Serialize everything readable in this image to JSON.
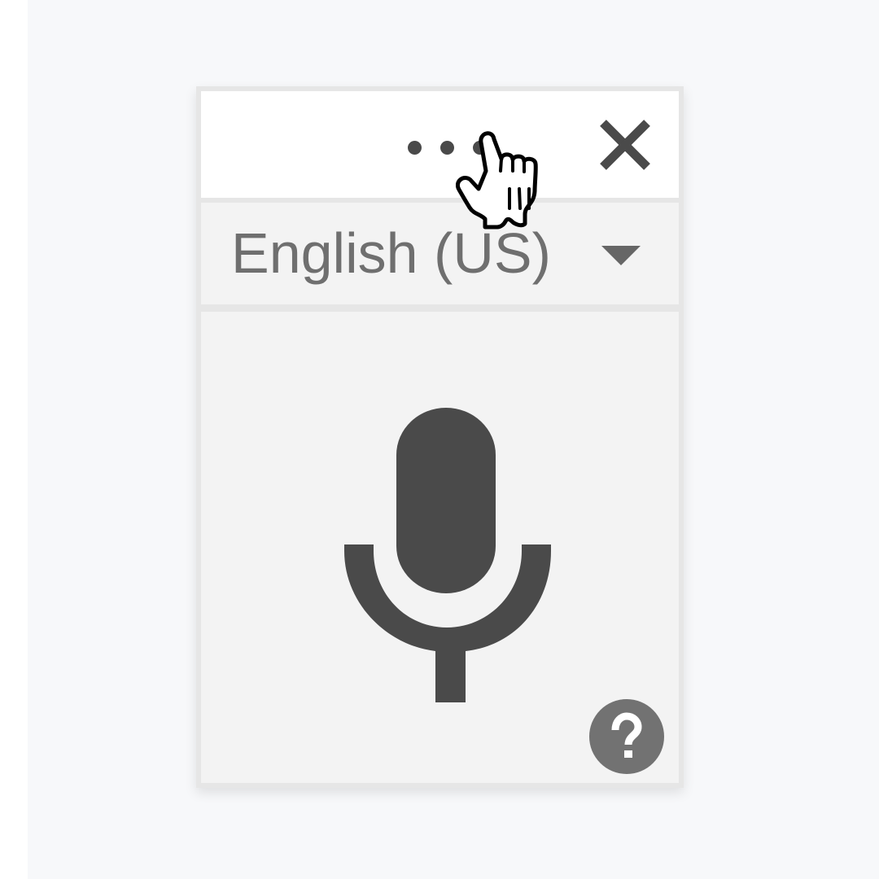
{
  "dialog": {
    "language": {
      "selected": "English (US)"
    },
    "icons": {
      "menu": "more-horizontal-icon",
      "close": "close-icon",
      "dropdown": "caret-down-icon",
      "microphone": "microphone-icon",
      "help": "help-icon",
      "cursor": "hand-pointer-icon"
    },
    "colors": {
      "icon": "#4a4a4a",
      "label": "#6f6f6f",
      "help_background": "#727272"
    }
  }
}
